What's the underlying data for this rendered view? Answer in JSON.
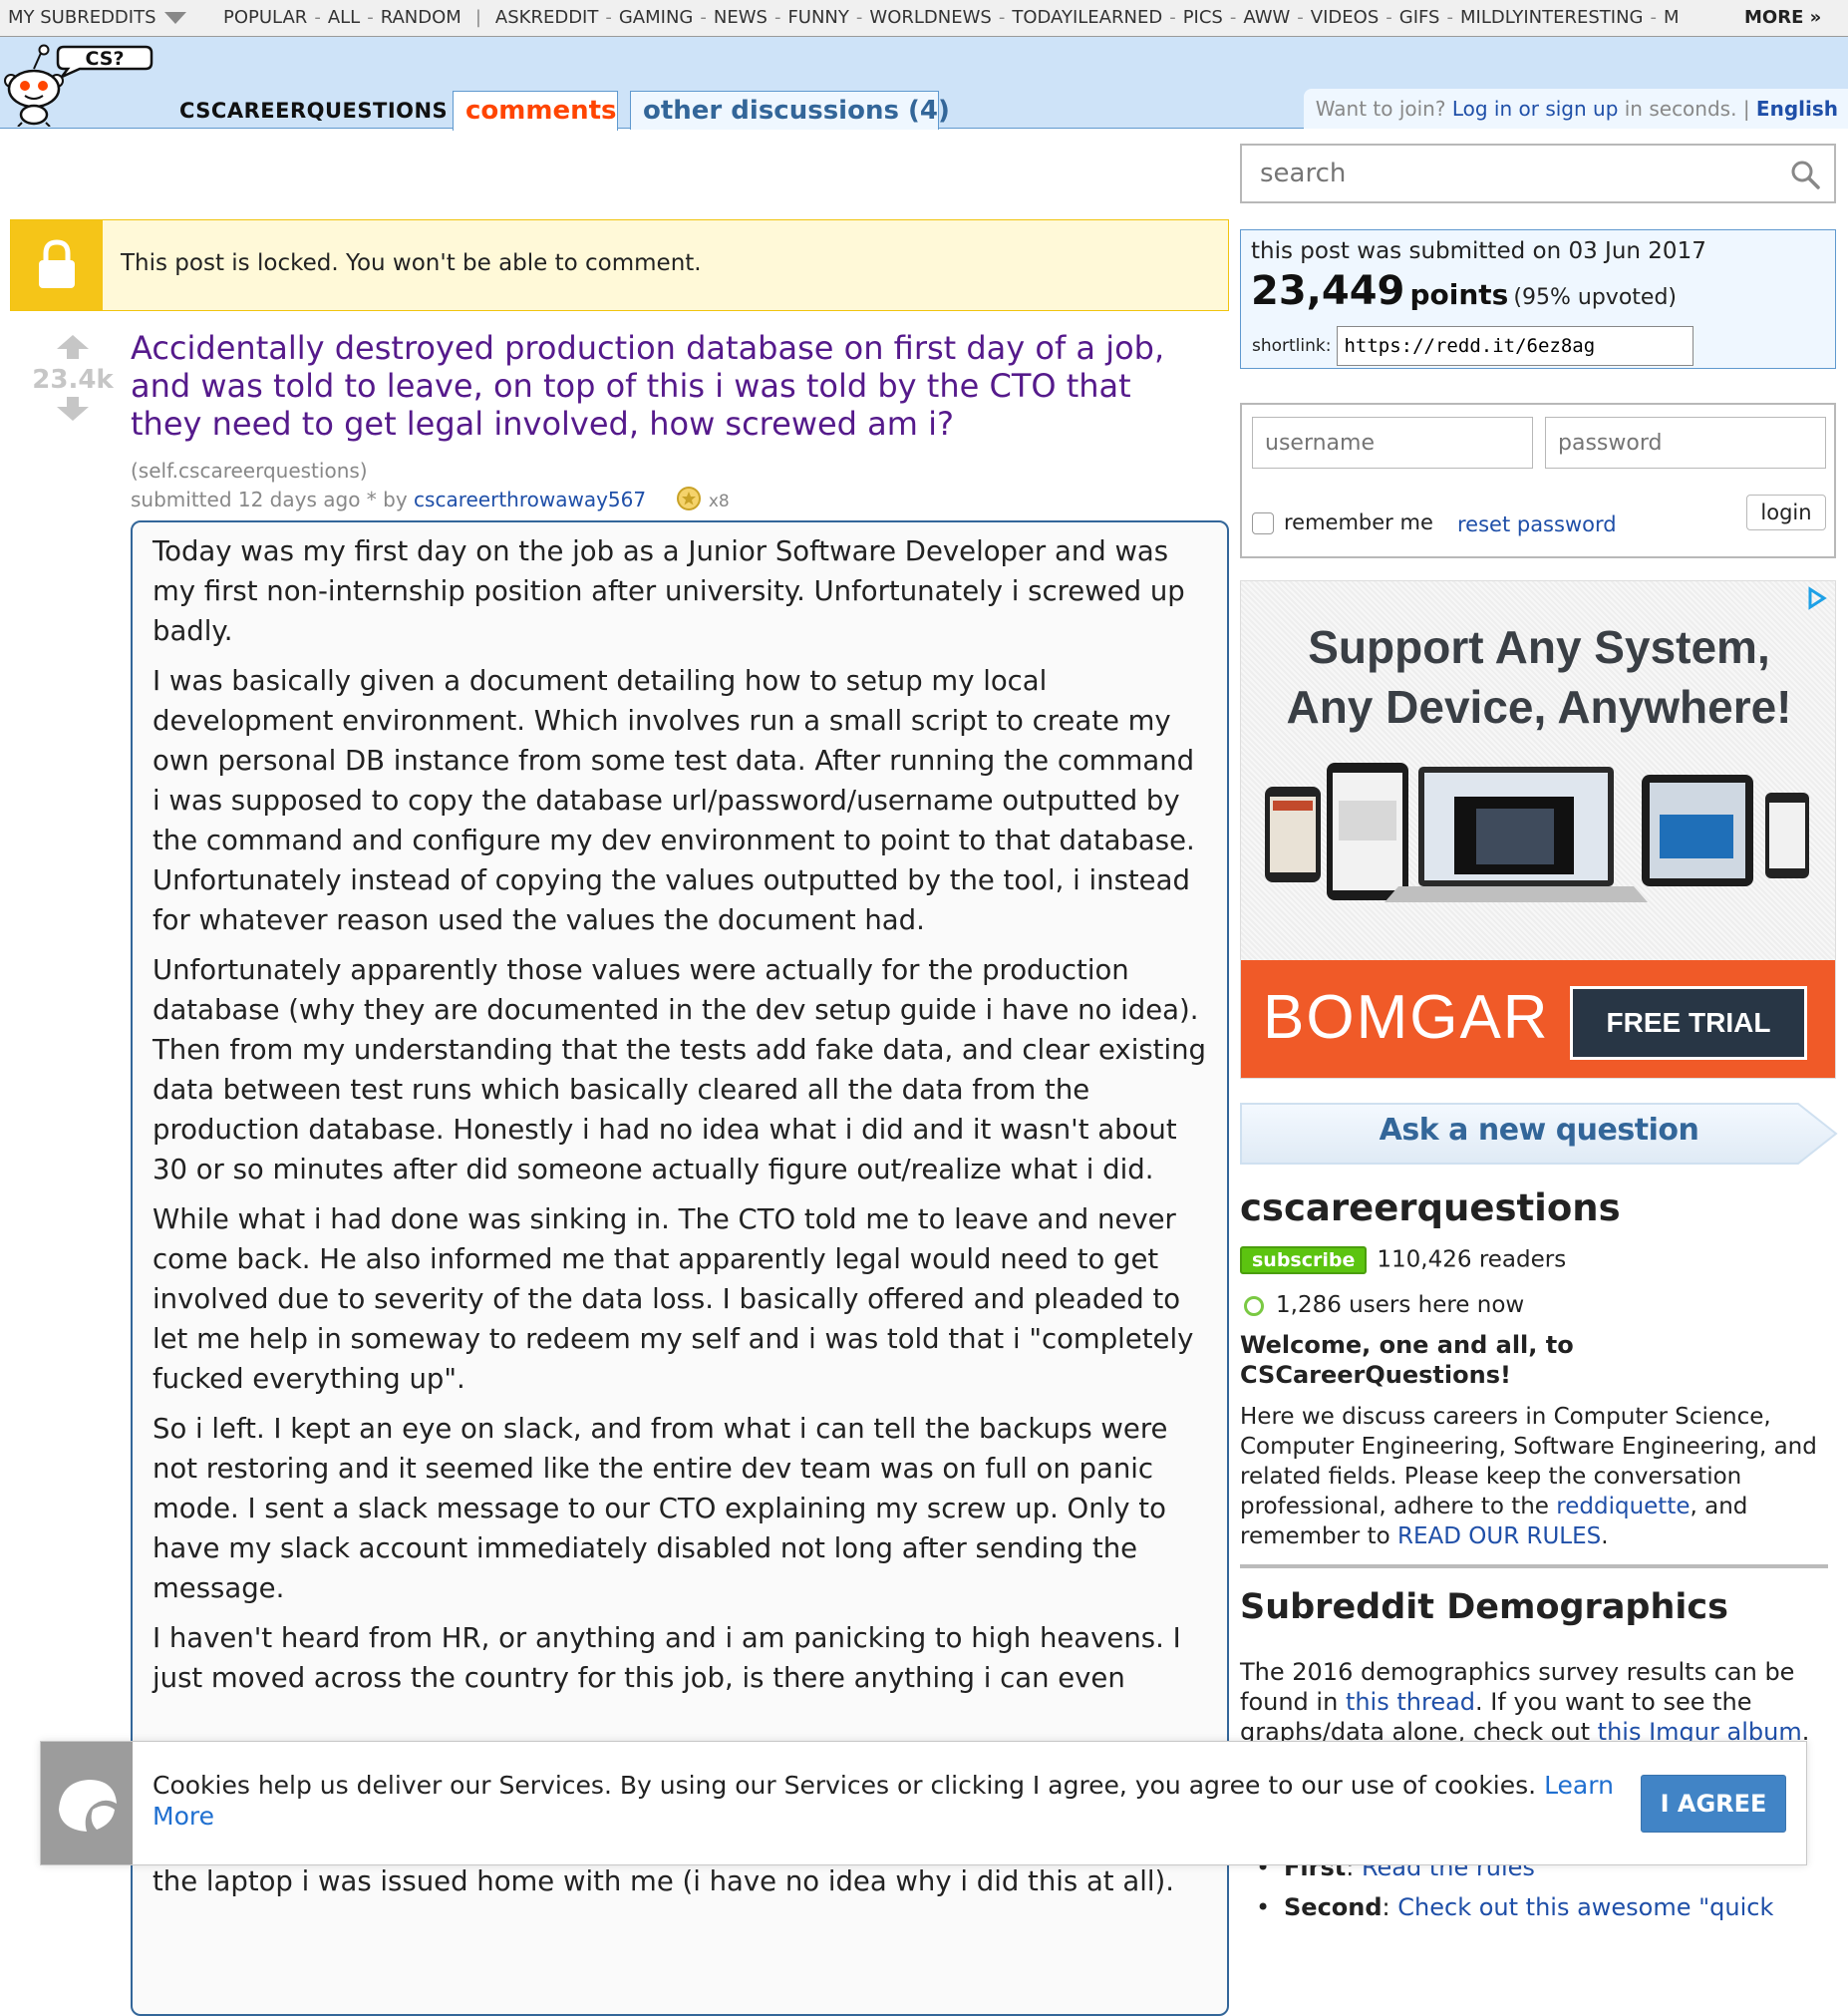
{
  "topbar": {
    "my_subreddits": "MY SUBREDDITS",
    "links_group1": [
      "POPULAR",
      "ALL",
      "RANDOM"
    ],
    "links_group2": [
      "ASKREDDIT",
      "GAMING",
      "NEWS",
      "FUNNY",
      "WORLDNEWS",
      "TODAYILEARNED",
      "PICS",
      "AWW",
      "VIDEOS",
      "GIFS",
      "MILDLYINTERESTING",
      "M"
    ],
    "more": "MORE »"
  },
  "header": {
    "logo_bubble": "CS?",
    "subreddit": "CSCAREERQUESTIONS",
    "tab_comments": "comments",
    "tab_other": "other discussions (4)",
    "join_text": "Want to join?",
    "login_link": "Log in or sign up",
    "join_suffix": "in seconds.",
    "language": "English"
  },
  "locked_banner": {
    "message": "This post is locked. You won't be able to comment."
  },
  "post": {
    "score": "23.4k",
    "title": "Accidentally destroyed production database on first day of a job, and was told to leave, on top of this i was told by the CTO that they need to get legal involved, how screwed am i?",
    "domain": "(self.cscareerquestions)",
    "submitted": "submitted 12 days ago * by",
    "author": "cscareerthrowaway567",
    "award_count": "x8",
    "paragraphs": [
      "Today was my first day on the job as a Junior Software Developer and was my first non-internship position after university. Unfortunately i screwed up badly.",
      "I was basically given a document detailing how to setup my local development environment. Which involves run a small script to create my own personal DB instance from some test data. After running the command i was supposed to copy the database url/password/username outputted by the command and configure my dev environment to point to that database. Unfortunately instead of copying the values outputted by the tool, i instead for whatever reason used the values the document had.",
      "Unfortunately apparently those values were actually for the production database (why they are documented in the dev setup guide i have no idea). Then from my understanding that the tests add fake data, and clear existing data between test runs which basically cleared all the data from the production database. Honestly i had no idea what i did and it wasn't about 30 or so minutes after did someone actually figure out/realize what i did.",
      "While what i had done was sinking in. The CTO told me to leave and never come back. He also informed me that apparently legal would need to get involved due to severity of the data loss. I basically offered and pleaded to let me help in someway to redeem my self and i was told that i \"completely fucked everything up\".",
      "So i left. I kept an eye on slack, and from what i can tell the backups were not restoring and it seemed like the entire dev team was on full on panic mode. I sent a slack message to our CTO explaining my screw up. Only to have my slack account immediately disabled not long after sending the message.",
      "I haven't heard from HR, or anything and i am panicking to high heavens. I just moved across the country for this job, is there anything i can even"
    ],
    "tail_line": "the laptop i was issued home with me (i have no idea why i did this at all)."
  },
  "sidebar": {
    "search_placeholder": "search",
    "submitted_on": "this post was submitted on 03 Jun 2017",
    "points": "23,449",
    "points_label": "points",
    "upvoted": "(95% upvoted)",
    "shortlink_label": "shortlink:",
    "shortlink": "https://redd.it/6ez8ag",
    "username_placeholder": "username",
    "password_placeholder": "password",
    "remember_me": "remember me",
    "reset_password": "reset password",
    "login_button": "login",
    "ad": {
      "headline_line1": "Support Any System,",
      "headline_line2": "Any Device, Anywhere!",
      "brand": "BOMGAR",
      "cta": "FREE TRIAL",
      "accent": "#f05a28"
    },
    "ask_button": "Ask a new question",
    "subreddit_title": "cscareerquestions",
    "subscribe": "subscribe",
    "readers": "110,426 readers",
    "online": "1,286 users here now",
    "welcome": "Welcome, one and all, to CSCareerQuestions!",
    "desc_before": "Here we discuss careers in Computer Science, Computer Engineering, Software Engineering, and related fields. Please keep the conversation professional, adhere to the",
    "desc_link1": "reddiquette",
    "desc_mid": ", and remember to",
    "desc_link2": "READ OUR RULES",
    "desc_end": ".",
    "demographics_title": "Subreddit Demographics",
    "demo_before": "The 2016 demographics survey results can be found in",
    "demo_link1": "this thread",
    "demo_mid": ". If you want to see the graphs/data alone, check out",
    "demo_link2": "this Imgur album",
    "demo_end": ".",
    "rules": [
      {
        "label": "First",
        "link": "Read the rules"
      },
      {
        "label": "Second",
        "link": "Check out this awesome \"quick"
      }
    ]
  },
  "cookie": {
    "text": "Cookies help us deliver our Services. By using our Services or clicking I agree, you agree to our use of cookies.",
    "learn_more": "Learn More",
    "agree": "I AGREE"
  },
  "colors": {
    "header_bg": "#cee3f8",
    "title_visited": "#551a8b",
    "link": "#1f4fa8",
    "locked_yellow": "#f5c518",
    "subscribe_green": "#5cc410",
    "agree_blue": "#4184c6"
  }
}
